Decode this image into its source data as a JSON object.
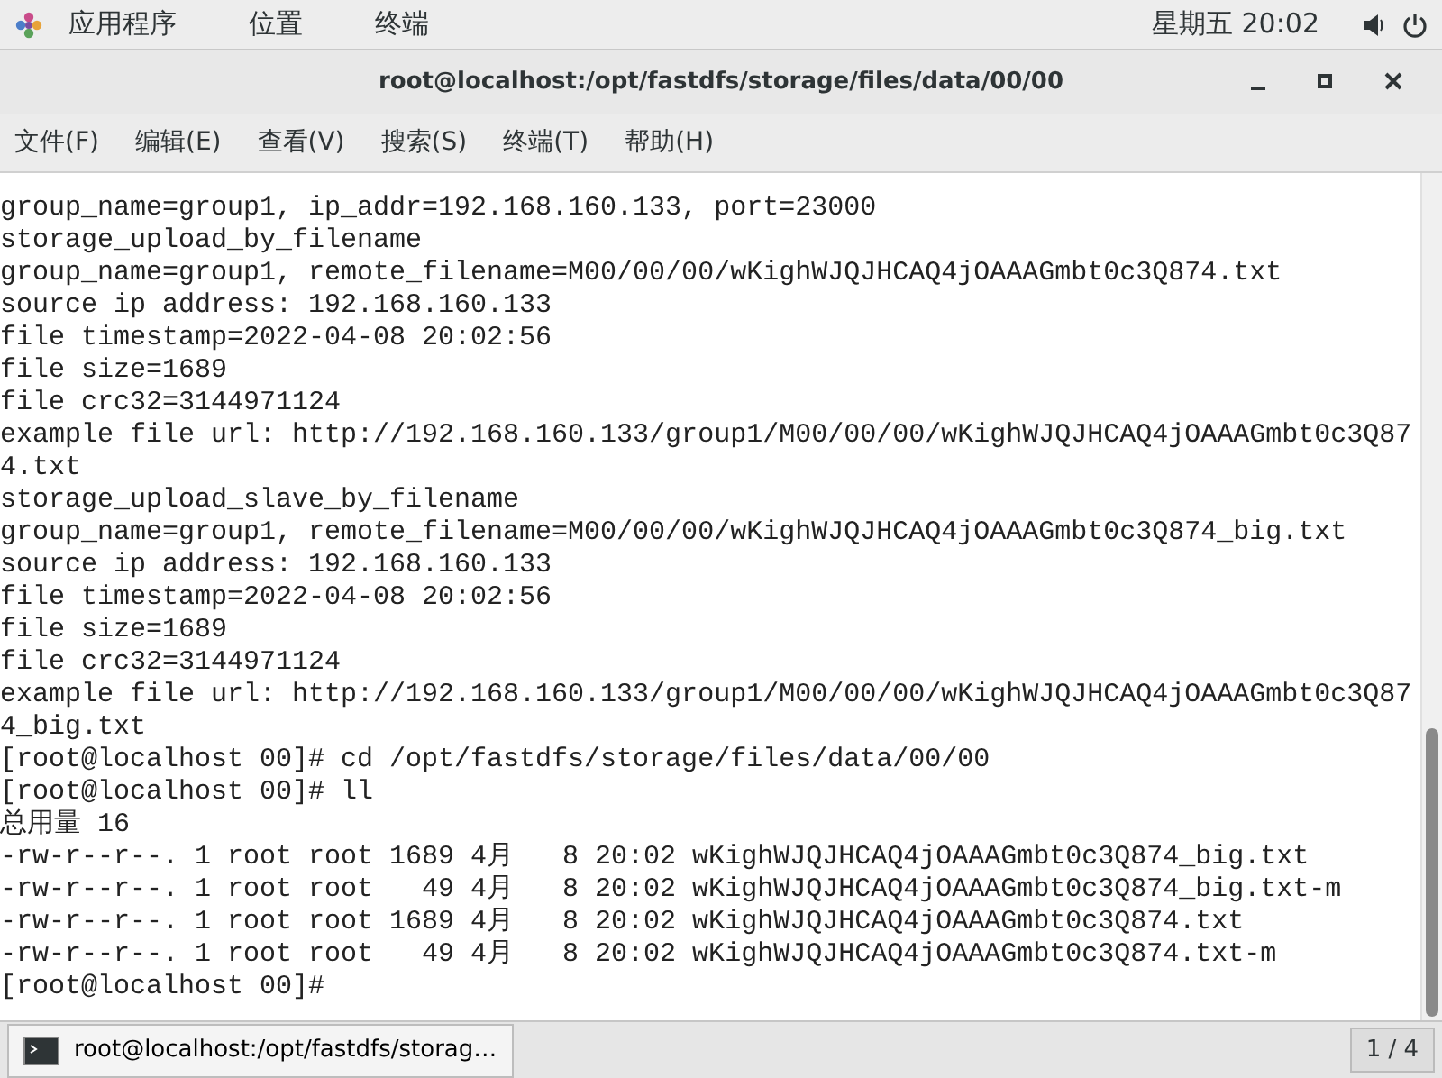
{
  "top_bar": {
    "menus": [
      "应用程序",
      "位置",
      "终端"
    ],
    "clock": "星期五 20:02"
  },
  "window": {
    "title": "root@localhost:/opt/fastdfs/storage/files/data/00/00"
  },
  "menu_bar": [
    "文件(F)",
    "编辑(E)",
    "查看(V)",
    "搜索(S)",
    "终端(T)",
    "帮助(H)"
  ],
  "terminal": {
    "lines": [
      "group_name=group1, ip_addr=192.168.160.133, port=23000",
      "storage_upload_by_filename",
      "group_name=group1, remote_filename=M00/00/00/wKighWJQJHCAQ4jOAAAGmbt0c3Q874.txt",
      "source ip address: 192.168.160.133",
      "file timestamp=2022-04-08 20:02:56",
      "file size=1689",
      "file crc32=3144971124",
      "example file url: http://192.168.160.133/group1/M00/00/00/wKighWJQJHCAQ4jOAAAGmbt0c3Q87",
      "4.txt",
      "storage_upload_slave_by_filename",
      "group_name=group1, remote_filename=M00/00/00/wKighWJQJHCAQ4jOAAAGmbt0c3Q874_big.txt",
      "source ip address: 192.168.160.133",
      "file timestamp=2022-04-08 20:02:56",
      "file size=1689",
      "file crc32=3144971124",
      "example file url: http://192.168.160.133/group1/M00/00/00/wKighWJQJHCAQ4jOAAAGmbt0c3Q87",
      "4_big.txt",
      "[root@localhost 00]# cd /opt/fastdfs/storage/files/data/00/00",
      "[root@localhost 00]# ll",
      "总用量 16",
      "-rw-r--r--. 1 root root 1689 4月   8 20:02 wKighWJQJHCAQ4jOAAAGmbt0c3Q874_big.txt",
      "-rw-r--r--. 1 root root   49 4月   8 20:02 wKighWJQJHCAQ4jOAAAGmbt0c3Q874_big.txt-m",
      "-rw-r--r--. 1 root root 1689 4月   8 20:02 wKighWJQJHCAQ4jOAAAGmbt0c3Q874.txt",
      "-rw-r--r--. 1 root root   49 4月   8 20:02 wKighWJQJHCAQ4jOAAAGmbt0c3Q874.txt-m",
      "[root@localhost 00]#"
    ]
  },
  "taskbar": {
    "task": "root@localhost:/opt/fastdfs/storag…",
    "workspace": "1 / 4"
  }
}
